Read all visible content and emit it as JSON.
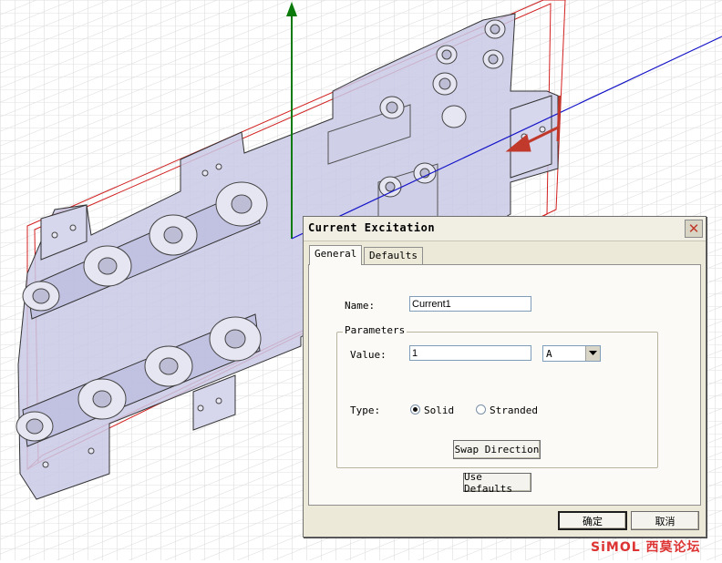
{
  "dialog": {
    "title": "Current Excitation",
    "tabs": [
      {
        "label": "General",
        "active": true
      },
      {
        "label": "Defaults",
        "active": false
      }
    ],
    "name_label": "Name:",
    "name_value": "Current1",
    "parameters_label": "Parameters",
    "value_label": "Value:",
    "value_value": "1",
    "unit": "A",
    "type_label": "Type:",
    "type_options": [
      {
        "label": "Solid",
        "selected": true
      },
      {
        "label": "Stranded",
        "selected": false
      }
    ],
    "swap_direction_label": "Swap Direction",
    "use_defaults_label": "Use Defaults",
    "ok_label": "确定",
    "cancel_label": "取消"
  },
  "watermark": "SiMOL 西莫论坛",
  "colors": {
    "axis_y": "#0a7a0a",
    "axis_x": "#1515c8",
    "bounding_box": "#d22020",
    "plate_fill": "#c9c9e6",
    "arrow": "#c0392b"
  }
}
